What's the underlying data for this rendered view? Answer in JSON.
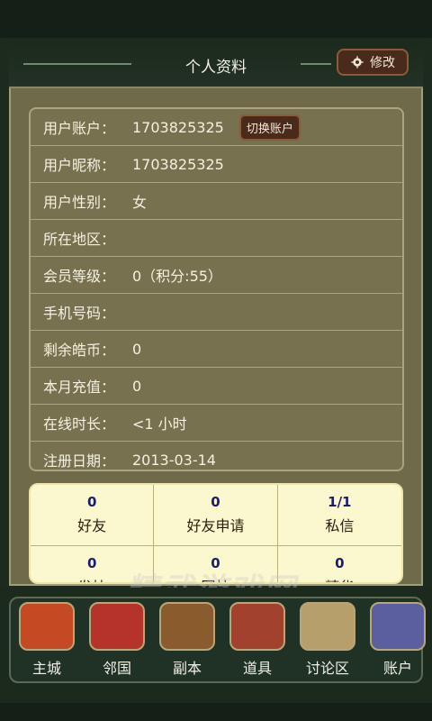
{
  "header": {
    "title": "个人资料",
    "edit_label": "修改"
  },
  "profile": [
    {
      "label": "用户账户：",
      "value": "1703825325",
      "action": "切换账户"
    },
    {
      "label": "用户昵称：",
      "value": "1703825325"
    },
    {
      "label": "用户性别：",
      "value": "女"
    },
    {
      "label": "所在地区：",
      "value": ""
    },
    {
      "label": "会员等级：",
      "value": "0（积分:55）"
    },
    {
      "label": "手机号码：",
      "value": ""
    },
    {
      "label": "剩余皓币：",
      "value": "0"
    },
    {
      "label": "本月充值：",
      "value": "0"
    },
    {
      "label": "在线时长：",
      "value": "<1 小时"
    },
    {
      "label": "注册日期：",
      "value": "2013-03-14"
    }
  ],
  "stats": [
    {
      "num": "0",
      "label": "好友"
    },
    {
      "num": "0",
      "label": "好友申请"
    },
    {
      "num": "1/1",
      "label": "私信"
    },
    {
      "num": "0",
      "label": "发帖"
    },
    {
      "num": "0",
      "label": "回帖"
    },
    {
      "num": "0",
      "label": "精华"
    }
  ],
  "watermark": "精武游戏网",
  "tabs": [
    {
      "label": "主城",
      "icon": "palace-icon",
      "color": "#c54a24"
    },
    {
      "label": "邻国",
      "icon": "flag-icon",
      "color": "#b6332b"
    },
    {
      "label": "副本",
      "icon": "shield-icon",
      "color": "#8a5b2d"
    },
    {
      "label": "道具",
      "icon": "chest-icon",
      "color": "#a2412d"
    },
    {
      "label": "讨论区",
      "icon": "board-icon",
      "color": "#b79f6b"
    },
    {
      "label": "账户",
      "icon": "avatar-icon",
      "color": "#5b5e9f"
    }
  ]
}
